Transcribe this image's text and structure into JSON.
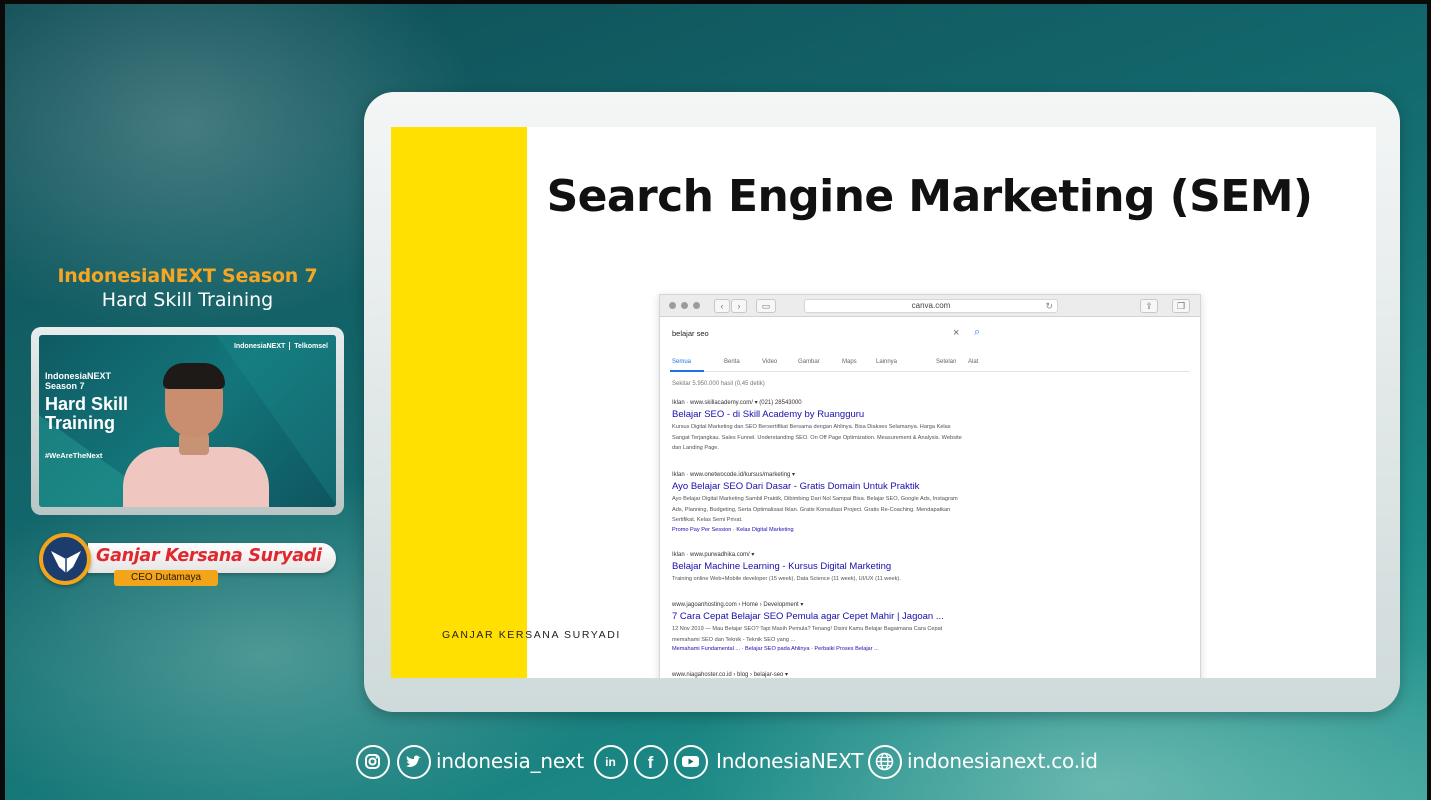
{
  "event": {
    "title": "IndonesiaNEXT Season 7",
    "subtitle": "Hard Skill Training"
  },
  "camera": {
    "brand_left": "IndonesiaNEXT",
    "brand_right": "Telkomsel",
    "card_small": "IndonesiaNEXT Season 7",
    "card_big": "Hard Skill Training",
    "hashtag": "#WeAreTheNext"
  },
  "speaker": {
    "name": "Ganjar Kersana Suryadi",
    "role": "CEO Dutamaya"
  },
  "slide": {
    "title": "Search Engine Marketing (SEM)",
    "author": "GANJAR KERSANA SURYADI",
    "browser": {
      "url": "canva.com",
      "query": "belajar seo",
      "tabs": [
        "Semua",
        "Berita",
        "Video",
        "Gambar",
        "Maps",
        "Lainnya",
        "Setelan",
        "Alat"
      ],
      "stats": "Sekitar 5.950.000 hasil (0,45 detik)",
      "results": [
        {
          "cite": "Iklan · www.skillacademy.com/ ▾ (021) 28543000",
          "title": "Belajar SEO - di Skill Academy by Ruangguru",
          "desc": "Kursus Digital Marketing dan SEO Bersertifikat Bersama dengan Ahlinya. Bisa Diakses Selamanya. Harga Kelas Sangat Terjangkau. Sales Funnel. Understanding SEO. On Off Page Optimization. Measurement & Analysis. Website dan Landing Page.",
          "links": ""
        },
        {
          "cite": "Iklan · www.onetwocode.id/kursus/marketing ▾",
          "title": "Ayo Belajar SEO Dari Dasar - Gratis Domain Untuk Praktik",
          "desc": "Ayo Belajar Digital Marketing Sambil Praktik, Dibimbing Dari Nol Sampai Bisa. Belajar SEO, Google Ads, Instagram Ads, Planning, Budgeting, Serta Optimalisasi Iklan. Gratis Konsultasi Project. Gratis Re-Coaching. Mendapatkan Sertifikat. Kelas Semi Privat.",
          "links": "Promo Pay Per Session · Kelas Digital Marketing"
        },
        {
          "cite": "Iklan · www.purwadhika.com/ ▾",
          "title": "Belajar Machine Learning - Kursus Digital Marketing",
          "desc": "Training online Web+Mobile developer (15 week), Data Science (11 week), UI/UX (11 week).",
          "links": ""
        },
        {
          "cite": "www.jagoanhosting.com › Home › Development ▾",
          "title": "7 Cara Cepat Belajar SEO Pemula agar Cepet Mahir | Jagoan ...",
          "desc": "12 Nov 2019 — Mau Belajar SEO? Tapi Masih Pemula? Tenang! Disini Kamu Belajar Bagaimana Cara Cepat memahami SEO dan Teknik - Teknik SEO yang ...",
          "links": "Memahami Fundamental ... · Belajar SEO pada Ahlinya · Perbaiki Proses Belajar ..."
        },
        {
          "cite": "www.niagahoster.co.id › blog › belajar-seo ▾",
          "title": "",
          "desc": "",
          "links": ""
        }
      ]
    }
  },
  "footer": {
    "handle": "indonesia_next",
    "page": "IndonesiaNEXT",
    "website": "indonesianext.co.id",
    "icons": [
      "instagram-icon",
      "twitter-icon",
      "linkedin-icon",
      "facebook-icon",
      "youtube-icon",
      "globe-icon"
    ]
  },
  "colors": {
    "accent_orange": "#f6a623",
    "speaker_red": "#e0282e",
    "slide_yellow": "#ffe000",
    "link_blue": "#1a0dab"
  }
}
